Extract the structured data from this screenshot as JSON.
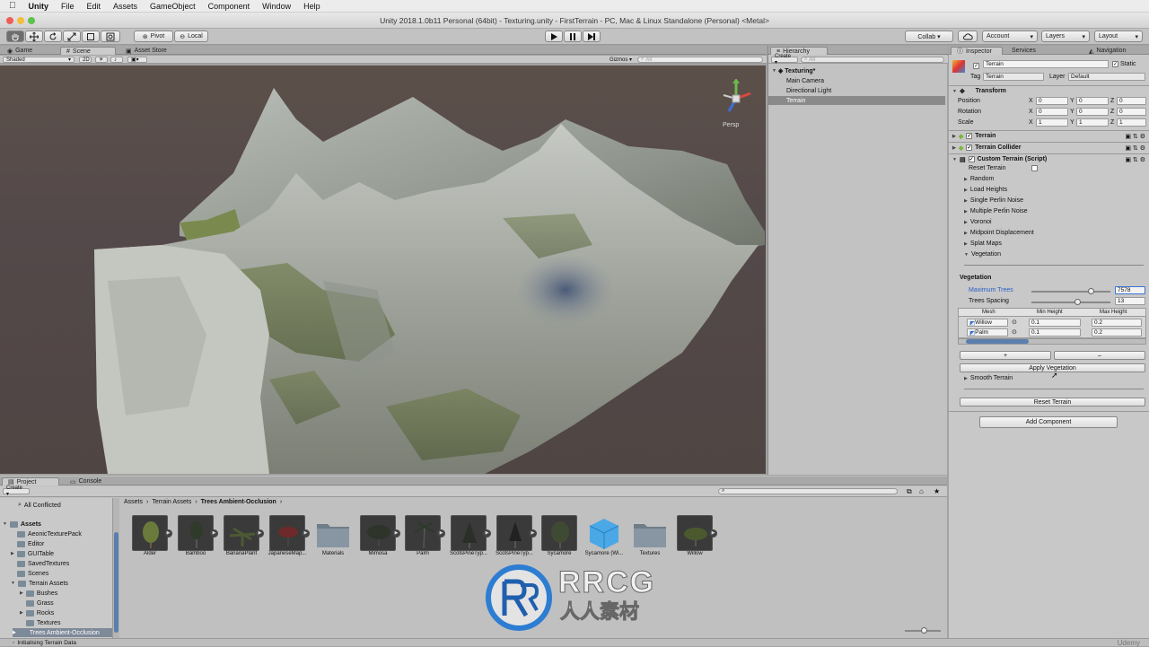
{
  "menubar": {
    "apple": "",
    "app": "Unity",
    "items": [
      "File",
      "Edit",
      "Assets",
      "GameObject",
      "Component",
      "Window",
      "Help"
    ]
  },
  "window": {
    "title": "Unity 2018.1.0b11 Personal (64bit) - Texturing.unity - FirstTerrain - PC, Mac & Linux Standalone (Personal) <Metal>"
  },
  "toolbar": {
    "pivot": "Pivot",
    "local": "Local",
    "collab": "Collab ▾",
    "account": "Account",
    "layers": "Layers",
    "layout": "Layout"
  },
  "scene": {
    "tabs": [
      "Game",
      "Scene",
      "Asset Store"
    ],
    "shading": "Shaded",
    "mode2d": "2D",
    "gizmos": "Gizmos ▾",
    "search_placeholder": "All",
    "persp": "Persp"
  },
  "hierarchy": {
    "tab": "Hierarchy",
    "create": "Create ▾",
    "search_placeholder": "All",
    "scene": "Texturing*",
    "items": [
      "Main Camera",
      "Directional Light",
      "Terrain"
    ],
    "selected": "Terrain"
  },
  "inspector": {
    "tabs": [
      "Inspector",
      "Services",
      "Navigation"
    ],
    "object_name": "Terrain",
    "static_label": "Static",
    "tag_label": "Tag",
    "tag_value": "Terrain",
    "layer_label": "Layer",
    "layer_value": "Default",
    "transform": {
      "title": "Transform",
      "rows": [
        {
          "label": "Position",
          "x": "0",
          "y": "0",
          "z": "0"
        },
        {
          "label": "Rotation",
          "x": "0",
          "y": "0",
          "z": "0"
        },
        {
          "label": "Scale",
          "x": "1",
          "y": "1",
          "z": "1"
        }
      ]
    },
    "components": [
      "Terrain",
      "Terrain Collider",
      "Custom Terrain (Script)"
    ],
    "reset_terrain_label": "Reset Terrain",
    "foldouts": [
      "Random",
      "Load Heights",
      "Single Perlin Noise",
      "Multiple Perlin Noise",
      "Voronoi",
      "Midpoint Displacement",
      "Splat Maps",
      "Vegetation"
    ],
    "vegetation": {
      "title": "Vegetation",
      "max_trees_label": "Maximum Trees",
      "max_trees_value": "7578",
      "max_trees_slider": 0.76,
      "spacing_label": "Trees Spacing",
      "spacing_value": "13",
      "spacing_slider": 0.58,
      "columns": [
        "Mesh",
        "Min Height",
        "Max Height"
      ],
      "rows": [
        {
          "mesh": "Willow",
          "min": "0.1",
          "max": "0.2"
        },
        {
          "mesh": "Palm",
          "min": "0.1",
          "max": "0.2"
        }
      ],
      "plus": "+",
      "minus": "–",
      "apply": "Apply Vegetation"
    },
    "smooth_terrain": "Smooth Terrain",
    "reset_button": "Reset Terrain",
    "add_component": "Add Component"
  },
  "project": {
    "tabs": [
      "Project",
      "Console"
    ],
    "create": "Create ▾",
    "tree": [
      {
        "label": "All Conflicted",
        "indent": 0
      },
      {
        "label": "Assets",
        "indent": 0,
        "bold": true
      },
      {
        "label": "AeonicTexturePack",
        "indent": 1
      },
      {
        "label": "Editor",
        "indent": 1
      },
      {
        "label": "GUITable",
        "indent": 1
      },
      {
        "label": "SavedTextures",
        "indent": 1
      },
      {
        "label": "Scenes",
        "indent": 1
      },
      {
        "label": "Terrain Assets",
        "indent": 1
      },
      {
        "label": "Bushes",
        "indent": 2
      },
      {
        "label": "Grass",
        "indent": 2
      },
      {
        "label": "Rocks",
        "indent": 2
      },
      {
        "label": "Textures",
        "indent": 2
      },
      {
        "label": "Trees Ambient-Occlusion",
        "indent": 2,
        "selected": true
      }
    ],
    "breadcrumb": [
      "Assets",
      "Terrain Assets",
      "Trees Ambient-Occlusion"
    ],
    "assets": [
      {
        "name": "Alder",
        "kind": "tree"
      },
      {
        "name": "Bamboo",
        "kind": "tree"
      },
      {
        "name": "BananaPlant",
        "kind": "tree"
      },
      {
        "name": "JapaneseMap...",
        "kind": "tree"
      },
      {
        "name": "Materials",
        "kind": "folder"
      },
      {
        "name": "Mimosa",
        "kind": "tree"
      },
      {
        "name": "Palm",
        "kind": "tree"
      },
      {
        "name": "ScotsPineTyp...",
        "kind": "tree"
      },
      {
        "name": "ScotsPineTyp...",
        "kind": "tree"
      },
      {
        "name": "Sycamore",
        "kind": "tree"
      },
      {
        "name": "Sycamore (Wi...",
        "kind": "cube"
      },
      {
        "name": "Textures",
        "kind": "folder"
      },
      {
        "name": "Willow",
        "kind": "tree"
      }
    ]
  },
  "status": "Initialising Terrain Data",
  "watermark": {
    "title": "RRCG",
    "subtitle": "人人素材"
  },
  "udemy": "Udemy"
}
